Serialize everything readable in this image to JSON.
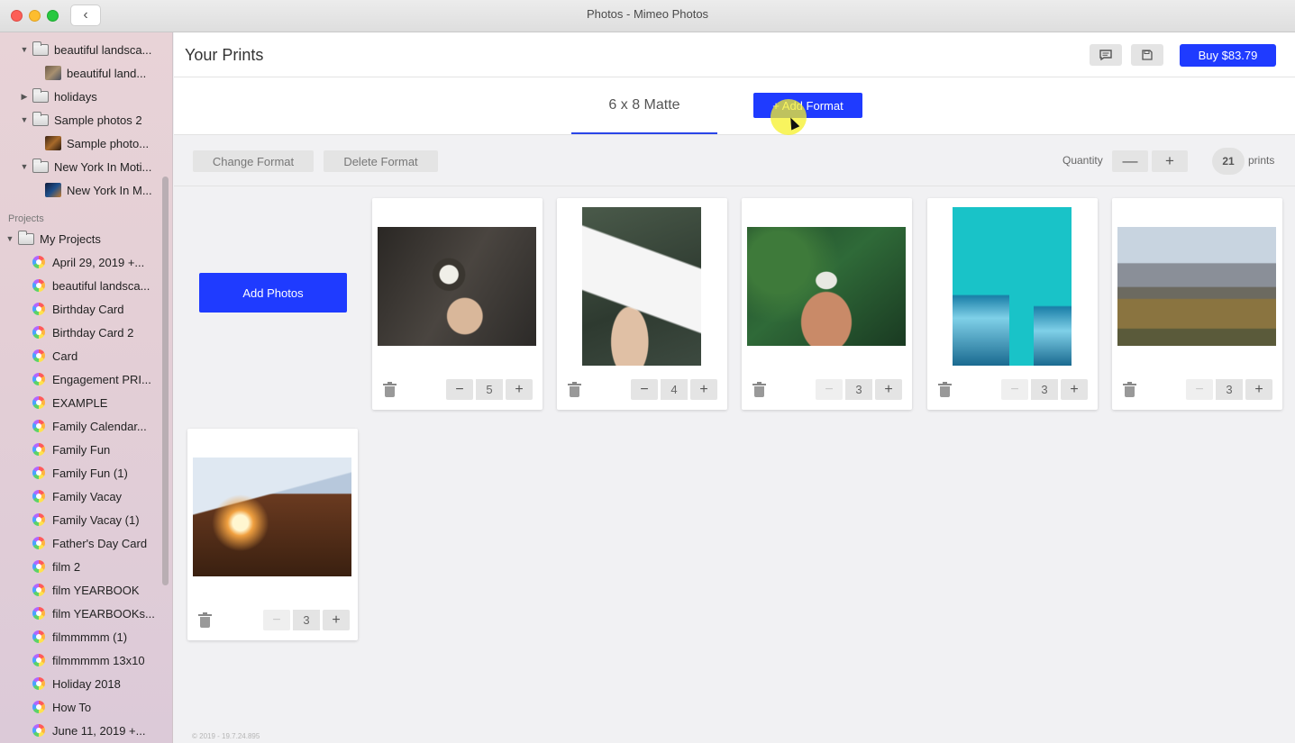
{
  "window": {
    "title": "Photos - Mimeo Photos"
  },
  "sidebar": {
    "albums": [
      {
        "label": "beautiful landsca...",
        "type": "folder",
        "expanded": true
      },
      {
        "label": "beautiful land...",
        "type": "photo"
      },
      {
        "label": "holidays",
        "type": "folder",
        "expanded": false
      },
      {
        "label": "Sample photos 2",
        "type": "folder",
        "expanded": true
      },
      {
        "label": "Sample photo...",
        "type": "photo"
      },
      {
        "label": "New York In Moti...",
        "type": "folder",
        "expanded": true
      },
      {
        "label": "New York In M...",
        "type": "photo"
      }
    ],
    "projects_section": "Projects",
    "projects_root": "My Projects",
    "projects": [
      "April 29, 2019 +...",
      "beautiful landsca...",
      "Birthday Card",
      "Birthday Card 2",
      "Card",
      "Engagement PRI...",
      "EXAMPLE",
      "Family Calendar...",
      "Family Fun",
      "Family Fun (1)",
      "Family Vacay",
      "Family Vacay (1)",
      "Father's Day Card",
      "film 2",
      "film YEARBOOK",
      "film YEARBOOKs...",
      "filmmmmm (1)",
      "filmmmmm 13x10",
      "Holiday 2018",
      "How To",
      "June 11, 2019 +..."
    ]
  },
  "header": {
    "title": "Your Prints",
    "buy_label": "Buy $83.79",
    "comment_icon": "chat-icon",
    "save_icon": "save-icon"
  },
  "tabs": {
    "active": "6 x 8 Matte",
    "add_format": "+ Add Format"
  },
  "toolbar": {
    "change_format": "Change Format",
    "delete_format": "Delete Format",
    "quantity_label": "Quantity",
    "minus": "—",
    "plus": "+",
    "total_prints": "21",
    "prints_label": "prints"
  },
  "add_photos": "Add Photos",
  "prints": [
    {
      "qty": "5",
      "minus_enabled": true
    },
    {
      "qty": "4",
      "minus_enabled": true
    },
    {
      "qty": "3",
      "minus_enabled": false
    },
    {
      "qty": "3",
      "minus_enabled": false
    },
    {
      "qty": "3",
      "minus_enabled": false
    },
    {
      "qty": "3",
      "minus_enabled": false
    }
  ],
  "stepper_glyphs": {
    "minus": "−",
    "plus": "+"
  },
  "footer": "© 2019 - 19.7.24.895",
  "colors": {
    "accent": "#1f3bff",
    "tab_underline": "#2a45e8"
  }
}
